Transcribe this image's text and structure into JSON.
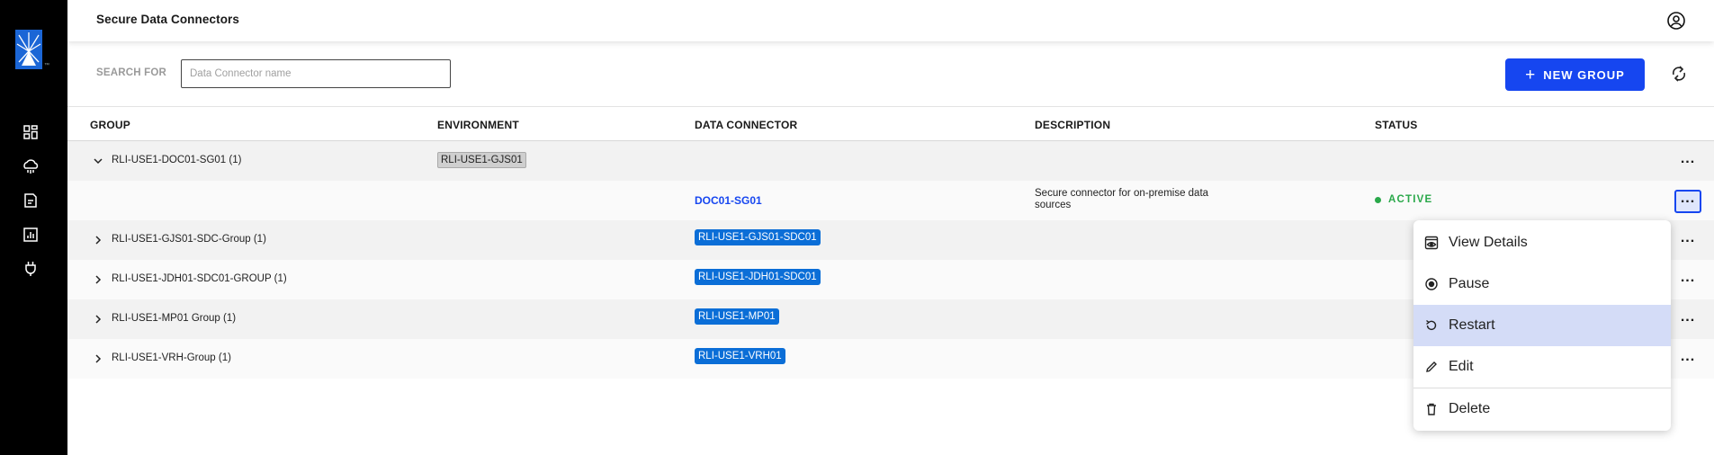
{
  "header": {
    "title": "Secure Data Connectors"
  },
  "search": {
    "label": "SEARCH FOR",
    "placeholder": "Data Connector name"
  },
  "toolbar": {
    "new_group_label": "NEW GROUP"
  },
  "table": {
    "columns": [
      "GROUP",
      "ENVIRONMENT",
      "DATA CONNECTOR",
      "DESCRIPTION",
      "STATUS"
    ],
    "rows": [
      {
        "group": "RLI-USE1-DOC01-SG01 (1)",
        "environment": "RLI-USE1-GJS01",
        "expanded": true
      },
      {
        "group": "",
        "data_connector": "DOC01-SG01",
        "description": "Secure connector for on-premise data sources",
        "status": "ACTIVE"
      },
      {
        "group": "RLI-USE1-GJS01-SDC-Group (1)",
        "data_connector": "RLI-USE1-GJS01-SDC01"
      },
      {
        "group": "RLI-USE1-JDH01-SDC01-GROUP (1)",
        "data_connector": "RLI-USE1-JDH01-SDC01"
      },
      {
        "group": "RLI-USE1-MP01 Group (1)",
        "data_connector": "RLI-USE1-MP01"
      },
      {
        "group": "RLI-USE1-VRH-Group (1)",
        "data_connector": "RLI-USE1-VRH01"
      }
    ]
  },
  "context_menu": {
    "items": [
      {
        "label": "View Details",
        "icon": "eye-icon"
      },
      {
        "label": "Pause",
        "icon": "pause-icon"
      },
      {
        "label": "Restart",
        "icon": "restart-icon",
        "highlighted": true
      },
      {
        "label": "Edit",
        "icon": "pencil-icon"
      },
      {
        "label": "Delete",
        "icon": "trash-icon"
      }
    ]
  },
  "sidebar": {
    "items": [
      {
        "icon": "dashboard-icon"
      },
      {
        "icon": "cloud-icon"
      },
      {
        "icon": "document-icon"
      },
      {
        "icon": "report-icon"
      },
      {
        "icon": "plug-icon"
      }
    ]
  },
  "colors": {
    "accent": "#1646f0",
    "tag_blue": "#0b6ed7",
    "status_active": "#2aa84a",
    "sidebar_bg": "#000000"
  }
}
